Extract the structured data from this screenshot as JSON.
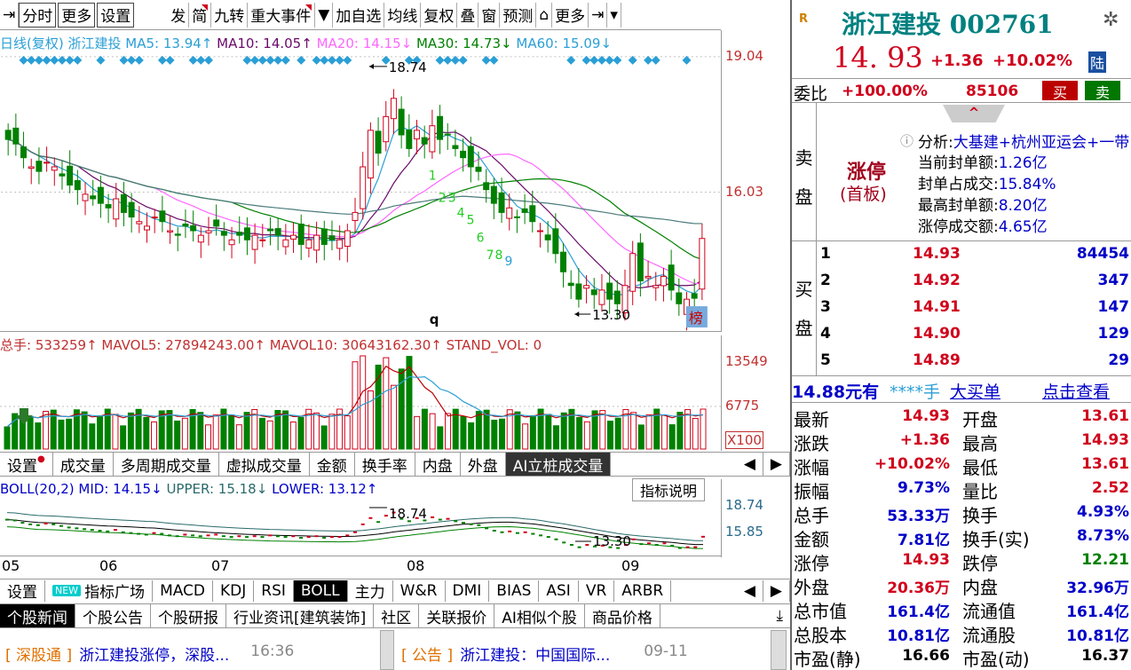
{
  "toolbar": {
    "items": [
      "分时",
      "更多",
      "设置",
      "发",
      "简",
      "九转",
      "重大事件",
      "加自选",
      "均线",
      "复权",
      "叠",
      "窗",
      "预测",
      "更多"
    ]
  },
  "main": {
    "legend": {
      "period": "日线(复权)",
      "name": "浙江建投",
      "ma5": "MA5: 13.94↑",
      "ma10": "MA10: 14.05↑",
      "ma20": "MA20: 14.15↓",
      "ma30": "MA30: 14.73↓",
      "ma60": "MA60: 15.09↓"
    },
    "high_label": "18.74",
    "low_label": "13.30",
    "q_label": "q",
    "count_labels": [
      "1",
      "2",
      "3",
      "4",
      "5",
      "6",
      "7",
      "8",
      "9"
    ],
    "axis": [
      "19.04",
      "16.03"
    ],
    "rank_icon": "榜"
  },
  "volume": {
    "legend": "总手: 533259↑ MAVOL5: 27894243.00↑ MAVOL10: 30643162.30↑ STAND_VOL: 0",
    "axis": [
      "13549",
      "6775",
      "X100"
    ]
  },
  "indicator_tabs": [
    "设置",
    "成交量",
    "多周期成交量",
    "虚拟成交量",
    "金额",
    "换手率",
    "内盘",
    "外盘",
    "AI立桩成交量"
  ],
  "indicator_help": "指标说明",
  "boll": {
    "legend_label": "BOLL(20,2) MID: 14.15↓",
    "upper": "UPPER: 15.18↓",
    "lower": "LOWER: 13.12↑",
    "axis": [
      "18.74",
      "15.85"
    ],
    "high_label": "18.74",
    "low_label": "13.30"
  },
  "dates": [
    "05",
    "06",
    "07",
    "08",
    "09"
  ],
  "bottom_tabs": [
    "设置",
    "指标广场",
    "MACD",
    "KDJ",
    "RSI",
    "BOLL",
    "主力",
    "W&R",
    "DMI",
    "BIAS",
    "ASI",
    "VR",
    "ARBR"
  ],
  "new_badge": "NEW",
  "news_tabs": [
    "个股新闻",
    "个股公告",
    "个股研报",
    "行业资讯[建筑装饰]",
    "社区",
    "关联报价",
    "AI相似个股",
    "商品价格"
  ],
  "news": [
    {
      "tag": "[ 深股通 ]",
      "title": "浙江建投涨停，深股...",
      "time": "16:36"
    },
    {
      "tag": "[ 公告 ]",
      "title": "浙江建投：中国国际...",
      "time": "09-11"
    }
  ],
  "quote": {
    "title": "浙江建投 002761",
    "price": "14. 93",
    "change": "+1.36",
    "pct": "+10.02%",
    "exch": "陆",
    "webi_label": "委比",
    "webi": "+100.00%",
    "webi_vol": "85106",
    "buy": "买",
    "sell": "卖",
    "sell_side_label": [
      "卖",
      "盘"
    ],
    "buy_side_label": [
      "买",
      "盘"
    ],
    "limit_title": "涨停",
    "limit_sub": "(首板)",
    "analysis_label": "分析:",
    "analysis": "大基建+杭州亚运会+一带",
    "stats": [
      {
        "k": "当前封单额:",
        "v": "1.26亿"
      },
      {
        "k": "封单占成交:",
        "v": "15.84%"
      },
      {
        "k": "最高封单额:",
        "v": "8.20亿"
      },
      {
        "k": "涨停成交额:",
        "v": "4.65亿"
      }
    ],
    "bids": [
      {
        "lvl": "1",
        "p": "14.93",
        "v": "84454"
      },
      {
        "lvl": "2",
        "p": "14.92",
        "v": "347"
      },
      {
        "lvl": "3",
        "p": "14.91",
        "v": "147"
      },
      {
        "lvl": "4",
        "p": "14.90",
        "v": "129"
      },
      {
        "lvl": "5",
        "p": "14.89",
        "v": "29"
      }
    ],
    "bigorder": {
      "a": "14.88元有",
      "b": "****手",
      "c": "大买单",
      "d": "点击查看"
    },
    "table": [
      [
        "最新",
        "14.93",
        "开盘",
        "13.61"
      ],
      [
        "涨跌",
        "+1.36",
        "最高",
        "14.93"
      ],
      [
        "涨幅",
        "+10.02%",
        "最低",
        "13.61"
      ],
      [
        "振幅",
        "9.73%",
        "量比",
        "2.52"
      ],
      [
        "总手",
        "53.33万",
        "换手",
        "4.93%"
      ],
      [
        "金额",
        "7.81亿",
        "换手(实)",
        "8.73%"
      ],
      [
        "涨停",
        "14.93",
        "跌停",
        "12.21"
      ],
      [
        "外盘",
        "20.36万",
        "内盘",
        "32.96万"
      ],
      [
        "总市值",
        "161.4亿",
        "流通值",
        "161.4亿"
      ],
      [
        "总股本",
        "10.81亿",
        "流通股",
        "10.81亿"
      ],
      [
        "市盈(静)",
        "16.66",
        "市盈(动)",
        "16.37"
      ]
    ]
  },
  "colors": {
    "up": "#d0021b",
    "down": "#008000",
    "ma5": "#2a9fd6",
    "ma10": "#6a0a6a",
    "ma20": "#ff66ff",
    "ma30": "#008000",
    "ma60": "#4a7a7a"
  }
}
